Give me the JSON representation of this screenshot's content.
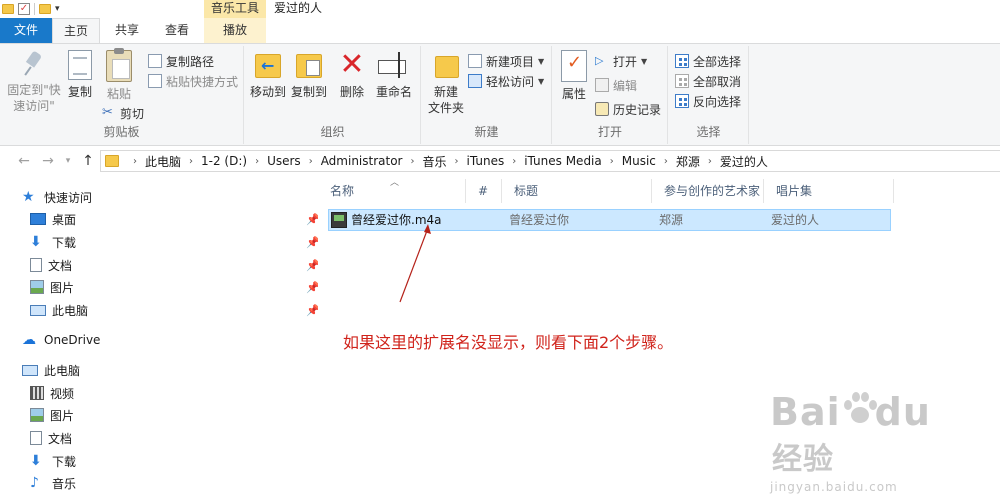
{
  "window": {
    "title": "爱过的人",
    "context_tab_group": "音乐工具"
  },
  "tabs": {
    "file": "文件",
    "home": "主页",
    "share": "共享",
    "view": "查看",
    "play": "播放"
  },
  "ribbon": {
    "clipboard": {
      "label": "剪贴板",
      "pin_line1": "固定到\"快",
      "pin_line2": "速访问\"",
      "copy": "复制",
      "paste": "粘贴",
      "copy_path": "复制路径",
      "paste_shortcut": "粘贴快捷方式",
      "cut": "剪切"
    },
    "organize": {
      "label": "组织",
      "move_to": "移动到",
      "copy_to": "复制到",
      "delete": "删除",
      "rename": "重命名"
    },
    "new": {
      "label": "新建",
      "new_folder_line1": "新建",
      "new_folder_line2": "文件夹",
      "new_item": "新建项目",
      "easy_access": "轻松访问"
    },
    "open": {
      "label": "打开",
      "properties": "属性",
      "open": "打开",
      "edit": "编辑",
      "history": "历史记录"
    },
    "select": {
      "label": "选择",
      "select_all": "全部选择",
      "select_none": "全部取消",
      "invert": "反向选择"
    }
  },
  "address": {
    "crumbs": [
      "此电脑",
      "1-2 (D:)",
      "Users",
      "Administrator",
      "音乐",
      "iTunes",
      "iTunes Media",
      "Music",
      "郑源",
      "爱过的人"
    ]
  },
  "navpane": {
    "quick_access": "快速访问",
    "qa_items": [
      "桌面",
      "下载",
      "文档",
      "图片",
      "此电脑"
    ],
    "onedrive": "OneDrive",
    "this_pc": "此电脑",
    "pc_items": [
      "视频",
      "图片",
      "文档",
      "下载",
      "音乐"
    ]
  },
  "filelist": {
    "columns": [
      "名称",
      "#",
      "标题",
      "参与创作的艺术家",
      "唱片集"
    ],
    "rows": [
      {
        "name": "曾经爱过你.m4a",
        "number": "",
        "title": "曾经爱过你",
        "artist": "郑源",
        "album": "爱过的人"
      }
    ]
  },
  "annotation": {
    "text": "如果这里的扩展名没显示，则看下面2个步骤。",
    "color": "#d0231b"
  },
  "watermark": {
    "brand": "Bai",
    "brand2": "du",
    "cn": "经验",
    "url": "jingyan.baidu.com"
  },
  "colors": {
    "file_tab": "#1979ca",
    "context_tab": "#fbe7a8",
    "selection": "#cce8ff",
    "delete_red": "#d9262b"
  }
}
